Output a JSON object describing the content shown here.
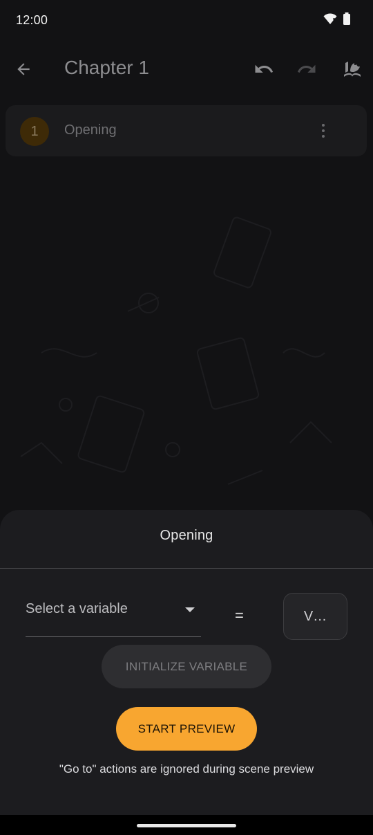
{
  "status_bar": {
    "time": "12:00"
  },
  "app_bar": {
    "title": "Chapter 1",
    "icons": [
      "arrow-back-icon",
      "undo-icon",
      "redo-icon",
      "book-flower-icon"
    ]
  },
  "scene_list": {
    "items": [
      {
        "number": "1",
        "label": "Opening"
      }
    ]
  },
  "sheet": {
    "title": "Opening",
    "variable_select": {
      "placeholder": "Select a variable"
    },
    "equals": "=",
    "value_field": {
      "text": "V…"
    },
    "initialize_button": "INITIALIZE VARIABLE",
    "start_preview_button": "START PREVIEW",
    "note": "\"Go to\" actions are ignored during scene preview"
  },
  "colors": {
    "accent": "#f8a630",
    "background": "#121214",
    "sheet": "#1c1c1f",
    "scene_badge": "#3e2a07"
  }
}
